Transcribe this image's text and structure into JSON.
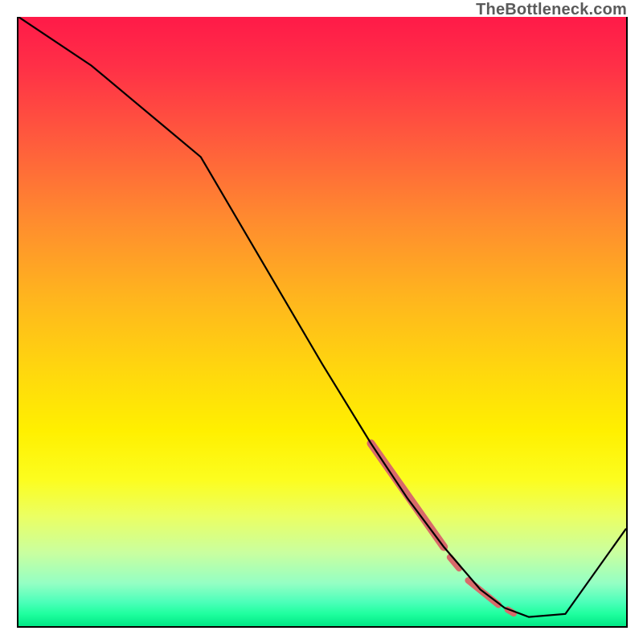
{
  "watermark": "TheBottleneck.com",
  "chart_data": {
    "type": "line",
    "title": "",
    "xlabel": "",
    "ylabel": "",
    "xlim": [
      0,
      100
    ],
    "ylim": [
      0,
      100
    ],
    "grid": false,
    "series": [
      {
        "name": "bottleneck-curve",
        "color": "#000000",
        "x": [
          0,
          12,
          24,
          30,
          40,
          50,
          58,
          64,
          70,
          76,
          80,
          84,
          90,
          100
        ],
        "y": [
          100,
          92,
          82,
          77,
          60,
          43,
          30,
          21,
          13,
          6,
          3,
          1.5,
          2,
          16
        ]
      }
    ],
    "highlight_segments": [
      {
        "name": "segment-a",
        "x_start": 58,
        "x_end": 70,
        "y_start": 30,
        "y_end": 13,
        "thickness": 10
      },
      {
        "name": "segment-b",
        "x_start": 71,
        "x_end": 72.5,
        "y_start": 11.3,
        "y_end": 9.5,
        "thickness": 8
      },
      {
        "name": "segment-c",
        "x_start": 74,
        "x_end": 79,
        "y_start": 7.5,
        "y_end": 3.5,
        "thickness": 8
      },
      {
        "name": "segment-d",
        "x_start": 80.5,
        "x_end": 81.5,
        "y_start": 2.7,
        "y_end": 2.1,
        "thickness": 8
      }
    ],
    "highlight_color": "#d86a6a",
    "background_gradient": {
      "top": "#ff1a48",
      "mid": "#fff000",
      "bottom": "#00e885"
    }
  }
}
